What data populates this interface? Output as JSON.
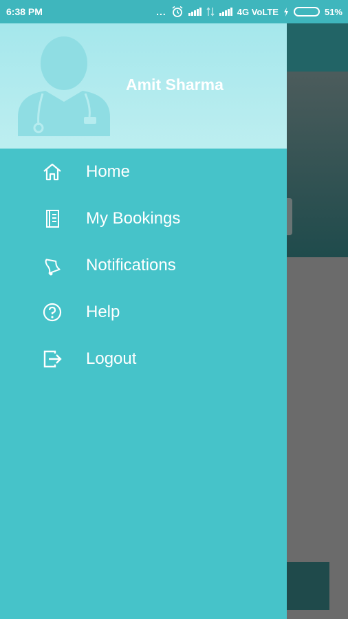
{
  "status_bar": {
    "time": "6:38 PM",
    "dots": "...",
    "network": "4G VoLTE",
    "battery": "51%",
    "battery_level": 0.51
  },
  "drawer": {
    "user_name": "Amit Sharma",
    "menu": [
      {
        "label": "Home",
        "icon": "home-icon"
      },
      {
        "label": "My Bookings",
        "icon": "document-icon"
      },
      {
        "label": "Notifications",
        "icon": "bell-icon"
      },
      {
        "label": "Help",
        "icon": "help-icon"
      },
      {
        "label": "Logout",
        "icon": "logout-icon"
      }
    ]
  },
  "colors": {
    "drawer_bg": "#46c3c9",
    "status_bar_bg": "#3fb6bd",
    "header_bg": "#a5e7ec",
    "scrim": "#6b6b6b"
  }
}
